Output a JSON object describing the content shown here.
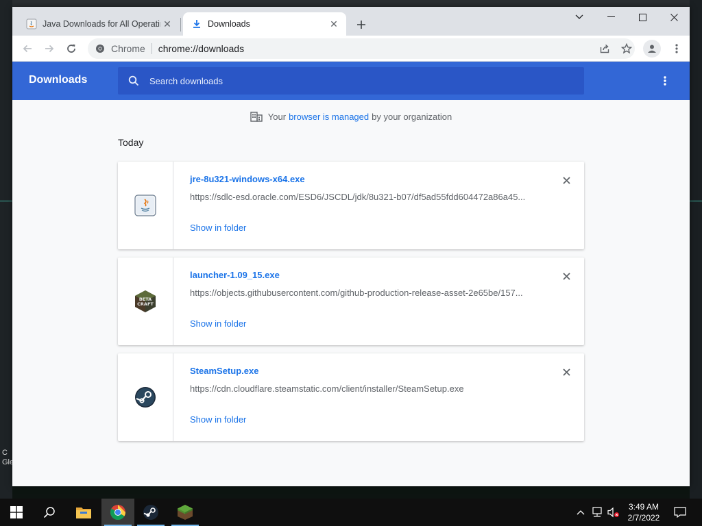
{
  "desktop": {
    "left_text_lines": [
      "C",
      "Gle"
    ]
  },
  "browser": {
    "tabs": [
      {
        "title": "Java Downloads for All Operating",
        "active": false,
        "favicon": "java-icon"
      },
      {
        "title": "Downloads",
        "active": true,
        "favicon": "download-icon"
      }
    ],
    "omnibox": {
      "chip": "Chrome",
      "url": "chrome://downloads"
    }
  },
  "downloads": {
    "title": "Downloads",
    "search_placeholder": "Search downloads",
    "managed": {
      "before": "Your",
      "link": "browser is managed",
      "after": "by your organization"
    },
    "date_group": "Today",
    "items": [
      {
        "filename": "jre-8u321-windows-x64.exe",
        "url": "https://sdlc-esd.oracle.com/ESD6/JSCDL/jdk/8u321-b07/df5ad55fdd604472a86a45...",
        "action": "Show in folder",
        "icon": "java-file-icon"
      },
      {
        "filename": "launcher-1.09_15.exe",
        "url": "https://objects.githubusercontent.com/github-production-release-asset-2e65be/157...",
        "action": "Show in folder",
        "icon": "betacraft-icon",
        "icon_text": [
          "BETA",
          "CRAFT"
        ]
      },
      {
        "filename": "SteamSetup.exe",
        "url": "https://cdn.cloudflare.steamstatic.com/client/installer/SteamSetup.exe",
        "action": "Show in folder",
        "icon": "steam-icon"
      }
    ]
  },
  "taskbar": {
    "time": "3:49 AM",
    "date": "2/7/2022"
  },
  "colors": {
    "header_blue": "#3367d6",
    "search_blue": "#2a56c6",
    "link_blue": "#1a73e8"
  }
}
